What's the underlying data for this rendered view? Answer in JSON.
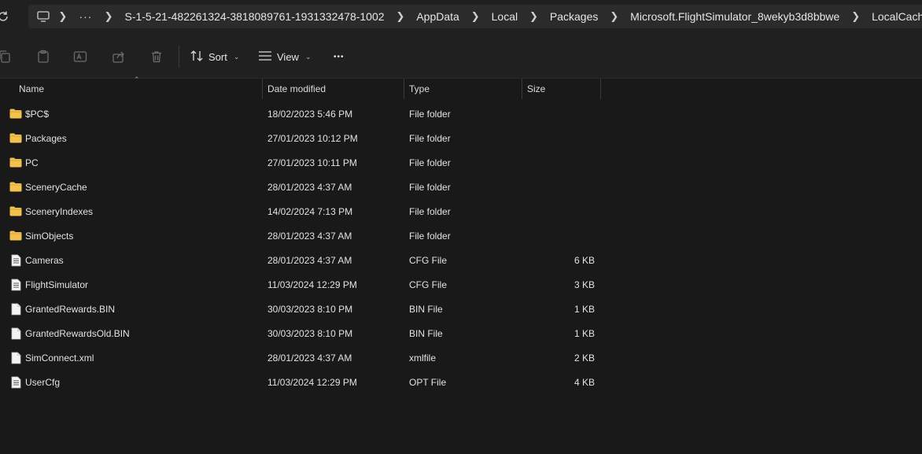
{
  "address": {
    "more": "···",
    "crumbs": [
      "S-1-5-21-482261324-3818089761-1931332478-1002",
      "AppData",
      "Local",
      "Packages",
      "Microsoft.FlightSimulator_8wekyb3d8bbwe",
      "LocalCache"
    ]
  },
  "toolbar": {
    "sort_label": "Sort",
    "view_label": "View",
    "more_label": "•••"
  },
  "columns": {
    "name": "Name",
    "date": "Date modified",
    "type": "Type",
    "size": "Size"
  },
  "files": [
    {
      "name": "$PC$",
      "date": "18/02/2023 5:46 PM",
      "type": "File folder",
      "size": "",
      "icon": "folder-icon"
    },
    {
      "name": "Packages",
      "date": "27/01/2023 10:12 PM",
      "type": "File folder",
      "size": "",
      "icon": "folder-icon"
    },
    {
      "name": "PC",
      "date": "27/01/2023 10:11 PM",
      "type": "File folder",
      "size": "",
      "icon": "folder-icon"
    },
    {
      "name": "SceneryCache",
      "date": "28/01/2023 4:37 AM",
      "type": "File folder",
      "size": "",
      "icon": "folder-icon"
    },
    {
      "name": "SceneryIndexes",
      "date": "14/02/2024 7:13 PM",
      "type": "File folder",
      "size": "",
      "icon": "folder-icon"
    },
    {
      "name": "SimObjects",
      "date": "28/01/2023 4:37 AM",
      "type": "File folder",
      "size": "",
      "icon": "folder-icon"
    },
    {
      "name": "Cameras",
      "date": "28/01/2023 4:37 AM",
      "type": "CFG File",
      "size": "6 KB",
      "icon": "text-file-icon"
    },
    {
      "name": "FlightSimulator",
      "date": "11/03/2024 12:29 PM",
      "type": "CFG File",
      "size": "3 KB",
      "icon": "text-file-icon"
    },
    {
      "name": "GrantedRewards.BIN",
      "date": "30/03/2023 8:10 PM",
      "type": "BIN File",
      "size": "1 KB",
      "icon": "blank-file-icon"
    },
    {
      "name": "GrantedRewardsOld.BIN",
      "date": "30/03/2023 8:10 PM",
      "type": "BIN File",
      "size": "1 KB",
      "icon": "blank-file-icon"
    },
    {
      "name": "SimConnect.xml",
      "date": "28/01/2023 4:37 AM",
      "type": "xmlfile",
      "size": "2 KB",
      "icon": "blank-file-icon"
    },
    {
      "name": "UserCfg",
      "date": "11/03/2024 12:29 PM",
      "type": "OPT File",
      "size": "4 KB",
      "icon": "text-file-icon"
    }
  ],
  "colors": {
    "folder": "#f2c14e",
    "background": "#191919",
    "toolbar": "#202020"
  }
}
